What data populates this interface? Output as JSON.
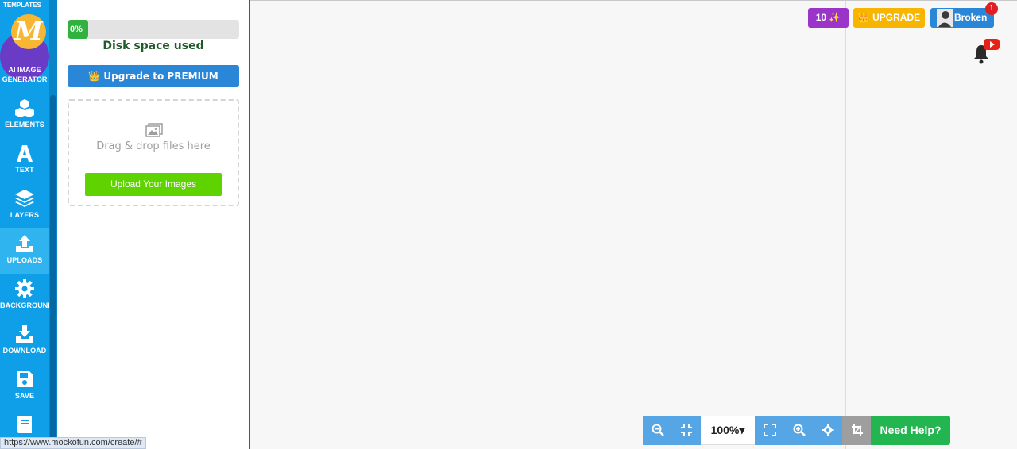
{
  "sidebar": {
    "top_partial_label": "TEMPLATES",
    "ai_generator": {
      "label_line1": "AI IMAGE",
      "label_line2": "GENERATOR",
      "logo_letter": "M"
    },
    "items": [
      {
        "label": "ELEMENTS",
        "icon": "cubes-icon"
      },
      {
        "label": "TEXT",
        "icon": "text-icon"
      },
      {
        "label": "LAYERS",
        "icon": "layers-icon"
      },
      {
        "label": "UPLOADS",
        "icon": "upload-icon",
        "active": true
      },
      {
        "label": "BACKGROUND",
        "icon": "gear-icon"
      },
      {
        "label": "DOWNLOAD",
        "icon": "download-icon"
      },
      {
        "label": "SAVE",
        "icon": "save-icon"
      },
      {
        "label": "",
        "icon": "book-icon"
      }
    ]
  },
  "uploads_panel": {
    "disk_percent_label": "0%",
    "disk_usage": 0.0,
    "disk_label": "Disk space used",
    "premium_button": "Upgrade to PREMIUM",
    "drop_text": "Drag & drop files here",
    "upload_button": "Upload Your Images"
  },
  "header": {
    "credits": "10 ✨",
    "upgrade": "UPGRADE",
    "user_name": "Broken",
    "notification_count": "1"
  },
  "toolbar": {
    "zoom_level": "100%▾",
    "help_button": "Need Help?"
  },
  "status_bar": {
    "url": "https://www.mockofun.com/create/#"
  },
  "colors": {
    "sidebar": "#0f9ee8",
    "premium": "#2a87d8",
    "upload_green": "#5ed300",
    "credits_purple": "#9b35c9",
    "upgrade_yellow": "#f7b500",
    "help_green": "#22b550"
  }
}
